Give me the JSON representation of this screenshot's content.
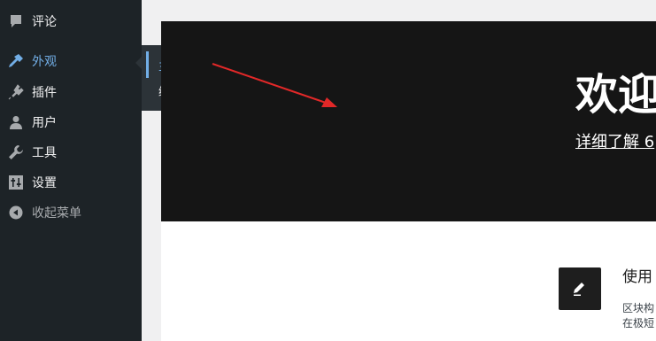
{
  "sidebar": {
    "items": [
      {
        "label": "评论",
        "icon": "comment-icon"
      },
      {
        "label": "外观",
        "icon": "appearance-icon",
        "active": true
      },
      {
        "label": "插件",
        "icon": "plugins-icon"
      },
      {
        "label": "用户",
        "icon": "users-icon"
      },
      {
        "label": "工具",
        "icon": "tools-icon"
      },
      {
        "label": "设置",
        "icon": "settings-icon"
      },
      {
        "label": "收起菜单",
        "icon": "collapse-icon"
      }
    ]
  },
  "flyout": {
    "items": [
      {
        "label": "主题",
        "current": true
      },
      {
        "label": "编辑"
      }
    ]
  },
  "hero": {
    "title": "欢迎",
    "link": "详细了解 6"
  },
  "feature": {
    "icon": "edit-icon",
    "title": "使用",
    "desc_line1": "区块构",
    "desc_line2": "在极短"
  },
  "colors": {
    "sidebar_bg": "#1d2327",
    "flyout_bg": "#2c3338",
    "accent": "#72aee6",
    "hero_bg": "#151515",
    "arrow": "#e22828"
  }
}
